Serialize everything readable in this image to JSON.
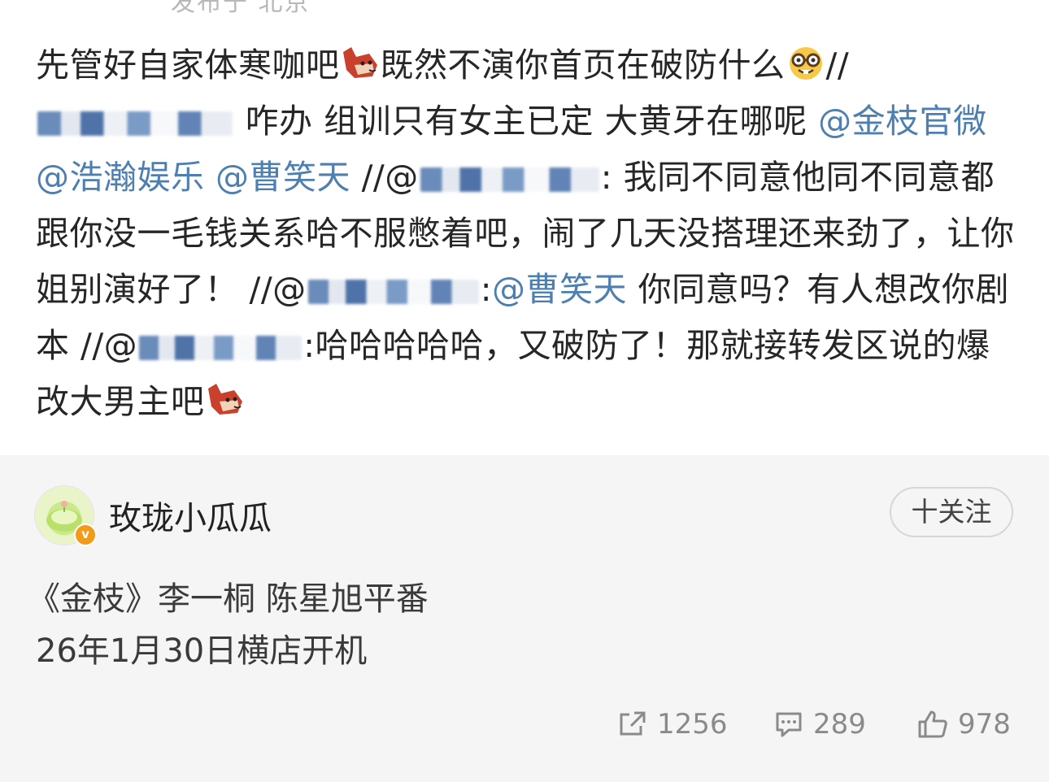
{
  "top_partial": "发布于 北京",
  "post": {
    "seg1": "先管好自家体寒咖吧",
    "seg2": "既然不演你首页在破防什么",
    "seg3": "//",
    "seg4": "咋办 组训只有女主已定 大黄牙在哪呢",
    "mention_jinzhi": "@金枝官微",
    "mention_haohan": "@浩瀚娱乐",
    "mention_caoxiaotian": "@曹笑天",
    "seg5": "//@",
    "seg6": ": 我同不同意他同不同意都跟你没一毛钱关系哈不服憋着吧，闹了几天没搭理还来劲了，让你姐别演好了！",
    "seg7": "//@",
    "seg8": ":",
    "mention_caoxiaotian2": "@曹笑天",
    "seg9": "你同意吗？有人想改你剧本",
    "seg10": "//@",
    "seg11": ":哈哈哈哈哈，又破防了！那就接转发区说的爆改大男主吧"
  },
  "author": {
    "name": "玫珑小瓜瓜",
    "badge": "v",
    "follow_label": "十关注"
  },
  "description": {
    "line1": "《金枝》李一桐 陈星旭平番",
    "line2": "26年1月30日横店开机"
  },
  "actions": {
    "repost_count": "1256",
    "comment_count": "289",
    "like_count": "978"
  },
  "colors": {
    "mention": "#4e7fb1",
    "section_bg": "#f5f5f5",
    "text": "#262626"
  }
}
